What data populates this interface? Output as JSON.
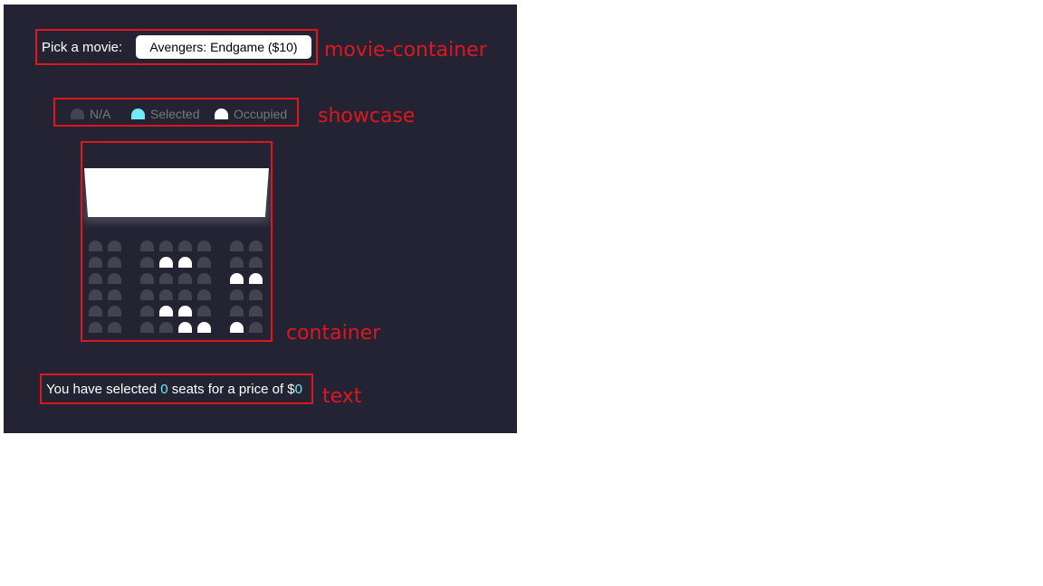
{
  "movie": {
    "label": "Pick a movie:",
    "selected": "Avengers: Endgame ($10)"
  },
  "showcase": {
    "items": [
      {
        "label": "N/A",
        "state": "na"
      },
      {
        "label": "Selected",
        "state": "sel"
      },
      {
        "label": "Occupied",
        "state": "occ"
      }
    ]
  },
  "seats": {
    "rows": [
      [
        "na",
        "na",
        "na",
        "na",
        "na",
        "na",
        "na",
        "na"
      ],
      [
        "na",
        "na",
        "na",
        "occ",
        "occ",
        "na",
        "na",
        "na"
      ],
      [
        "na",
        "na",
        "na",
        "na",
        "na",
        "na",
        "occ",
        "occ"
      ],
      [
        "na",
        "na",
        "na",
        "na",
        "na",
        "na",
        "na",
        "na"
      ],
      [
        "na",
        "na",
        "na",
        "occ",
        "occ",
        "na",
        "na",
        "na"
      ],
      [
        "na",
        "na",
        "na",
        "na",
        "occ",
        "occ",
        "occ",
        "na"
      ]
    ]
  },
  "summary": {
    "prefix": "You have selected",
    "count": "0",
    "middle": "seats for a price of $",
    "price": "0"
  },
  "annotations": {
    "movie_container": "movie-container",
    "showcase": "showcase",
    "container": "container",
    "text": "text"
  },
  "colors": {
    "background": "#242333",
    "seat_na": "#444451",
    "seat_selected": "#6feaf6",
    "seat_occupied": "#ffffff",
    "annotation": "#e0161f"
  }
}
